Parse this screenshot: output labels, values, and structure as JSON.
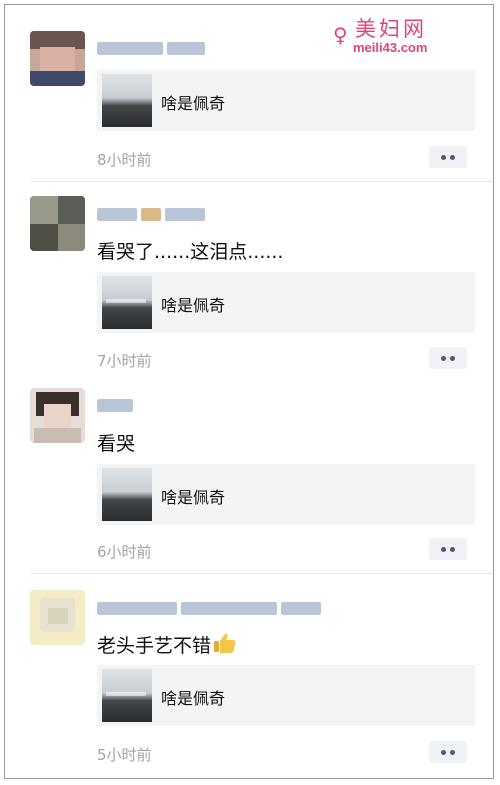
{
  "watermark": {
    "logo_icon": "woman-silhouette-icon",
    "title": "美妇网",
    "url": "meili43.com",
    "color": "#e0457a"
  },
  "comments": [
    {
      "text": "",
      "card_title": "啥是佩奇",
      "time": "8小时前"
    },
    {
      "text": "看哭了......这泪点......",
      "card_title": "啥是佩奇",
      "time": "7小时前"
    },
    {
      "text": "看哭",
      "card_title": "啥是佩奇",
      "time": "6小时前"
    },
    {
      "text": "老头手艺不错",
      "emoji": "thumbs-up-icon",
      "card_title": "啥是佩奇",
      "time": "5小时前"
    }
  ],
  "colors": {
    "time_text": "#a3a3a3",
    "card_bg": "#f4f4f4",
    "more_dots": "#4e5a77"
  }
}
